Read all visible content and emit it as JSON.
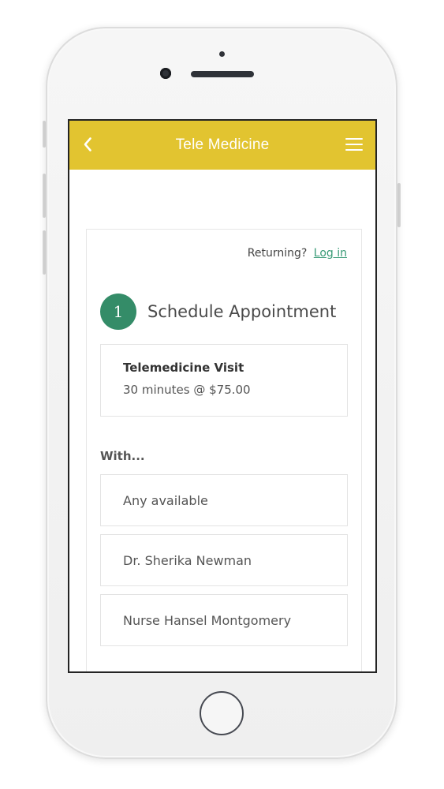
{
  "header": {
    "title": "Tele Medicine",
    "back_icon": "chevron-left-icon",
    "menu_icon": "hamburger-menu-icon",
    "background_color": "#e2c430"
  },
  "login_prompt": {
    "text": "Returning?",
    "link": "Log in"
  },
  "step": {
    "number": "1",
    "title": "Schedule Appointment",
    "badge_color": "#348c68"
  },
  "service": {
    "name": "Telemedicine Visit",
    "details": "30 minutes @ $75.00"
  },
  "providers": {
    "label": "With...",
    "items": [
      "Any available",
      "Dr. Sherika Newman",
      "Nurse Hansel Montgomery"
    ]
  }
}
